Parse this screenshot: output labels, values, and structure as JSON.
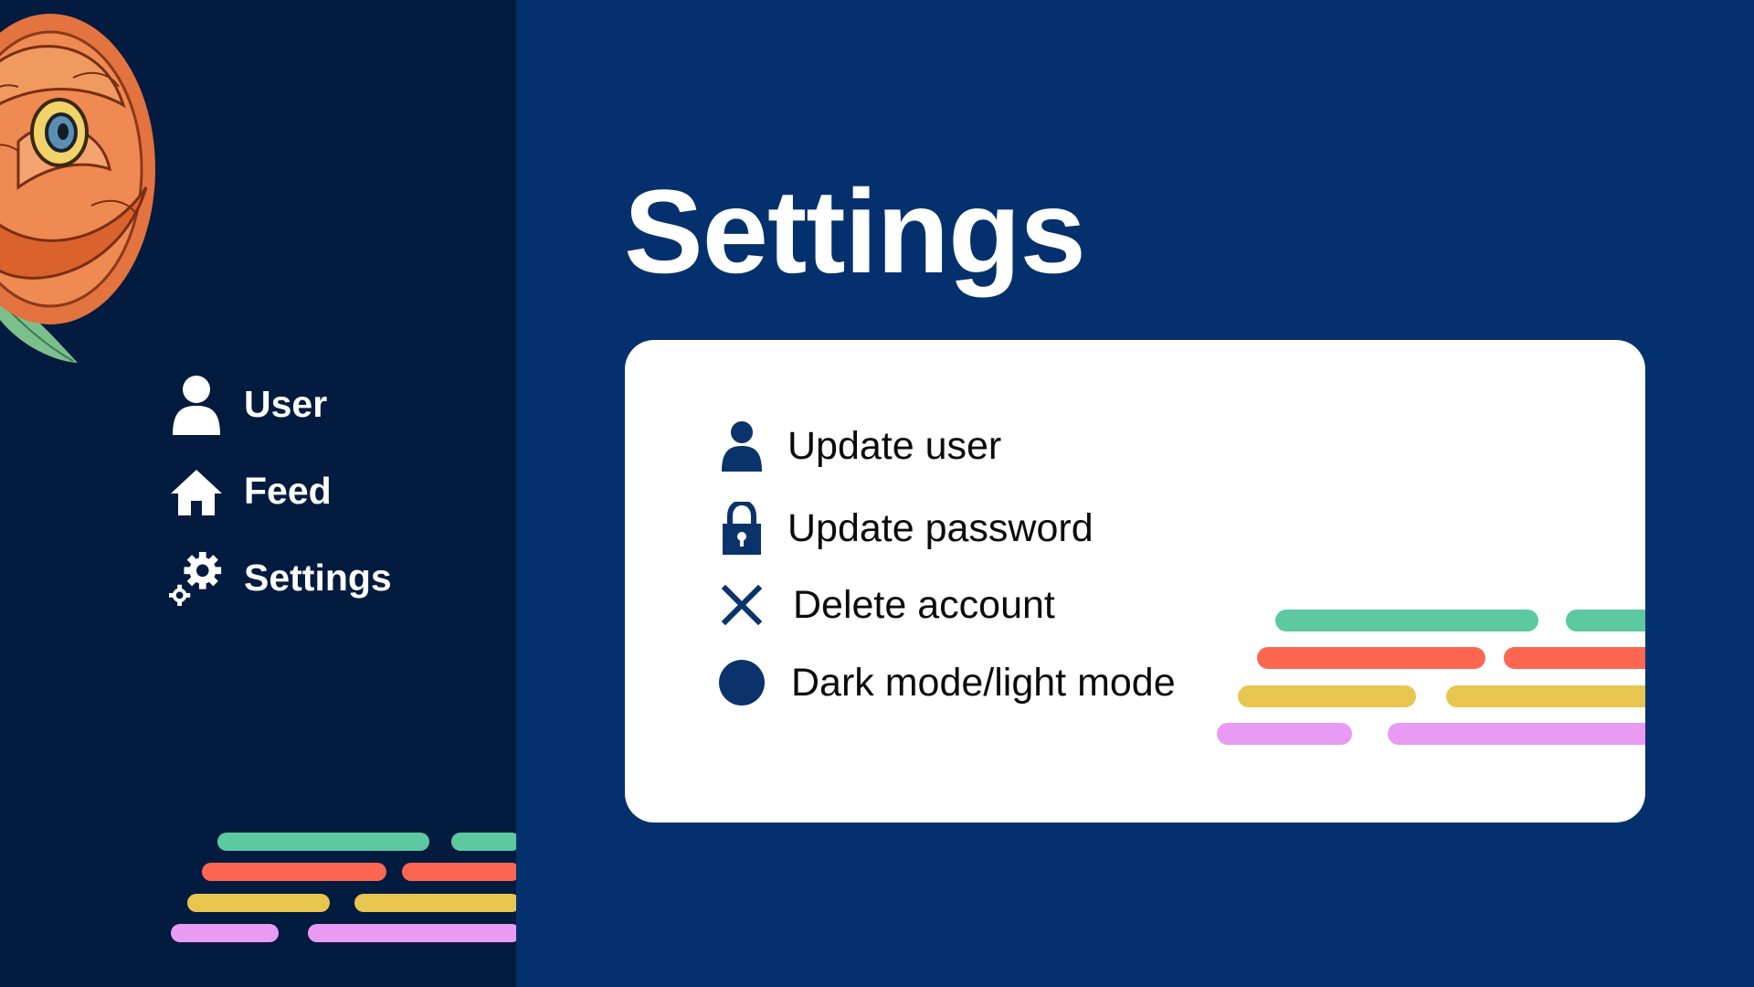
{
  "sidebar": {
    "items": [
      {
        "label": "User",
        "icon": "user-icon"
      },
      {
        "label": "Feed",
        "icon": "home-icon"
      },
      {
        "label": "Settings",
        "icon": "gears-icon"
      }
    ]
  },
  "main": {
    "title": "Settings",
    "options": [
      {
        "label": "Update user",
        "icon": "user-icon"
      },
      {
        "label": "Update password",
        "icon": "lock-icon"
      },
      {
        "label": "Delete account",
        "icon": "close-icon"
      },
      {
        "label": "Dark mode/light mode",
        "icon": "circle-icon"
      }
    ]
  },
  "colors": {
    "sidebar_bg": "#031b3f",
    "main_bg": "#04316d",
    "card_bg": "#ffffff",
    "accent_navy": "#0a336b",
    "stripe_green": "#5cc9a0",
    "stripe_red": "#fd6752",
    "stripe_yellow": "#e7c54f",
    "stripe_pink": "#e99bf3"
  }
}
